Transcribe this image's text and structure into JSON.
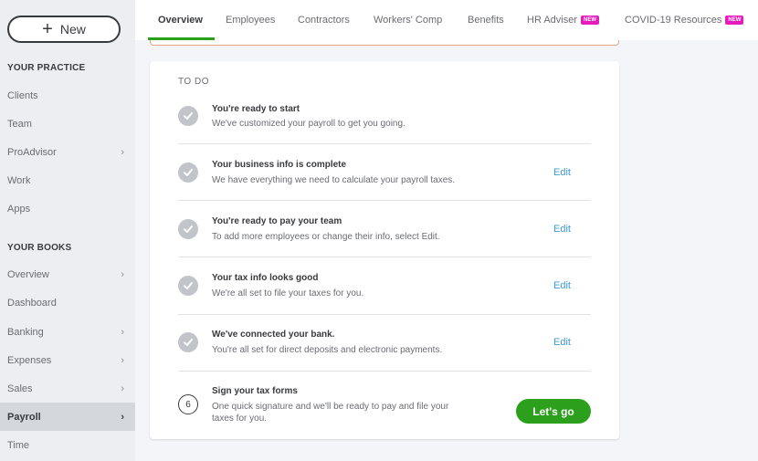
{
  "sidebar": {
    "new_label": "New",
    "practice_heading": "YOUR PRACTICE",
    "practice_items": [
      "Clients",
      "Team",
      "ProAdvisor",
      "Work",
      "Apps"
    ],
    "books_heading": "YOUR BOOKS",
    "books_items": [
      "Overview",
      "Dashboard",
      "Banking",
      "Expenses",
      "Sales",
      "Payroll",
      "Time"
    ],
    "active_item": "Payroll"
  },
  "tabs": {
    "items": [
      "Overview",
      "Employees",
      "Contractors",
      "Workers' Comp",
      "Benefits",
      "HR Adviser",
      "COVID-19 Resources"
    ],
    "active": "Overview",
    "new_badge": "NEW"
  },
  "todo": {
    "title": "TO DO",
    "edit_label": "Edit",
    "tasks": [
      {
        "title": "You're ready to start",
        "desc": "We've customized your payroll to get you going."
      },
      {
        "title": "Your business info is complete",
        "desc": "We have everything we need to calculate your payroll taxes."
      },
      {
        "title": "You're ready to pay your team",
        "desc": "To add more employees or change their info, select Edit."
      },
      {
        "title": "Your tax info looks good",
        "desc": "We're all set to file your taxes for you."
      },
      {
        "title": "We've connected your bank.",
        "desc": "You're all set for direct deposits and electronic payments."
      },
      {
        "number": "6",
        "title": "Sign your tax forms",
        "desc_line1": "One quick signature and we'll be ready to pay and file your",
        "desc_line2": "taxes for you."
      }
    ],
    "go_label": "Let's go"
  },
  "colors": {
    "accent": "#2ca01c",
    "link": "#3d9bd1",
    "badge": "#e51bbd"
  }
}
